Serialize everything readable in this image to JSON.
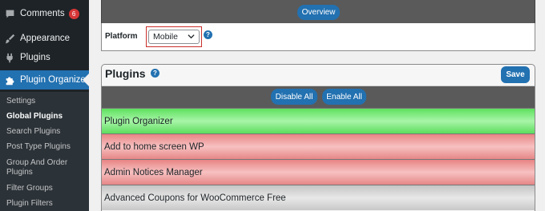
{
  "sidebar": {
    "items": [
      {
        "label": "Comments",
        "icon": "comment-icon",
        "badge": "6"
      },
      {
        "label": "Appearance",
        "icon": "paintbrush-icon"
      },
      {
        "label": "Plugins",
        "icon": "plugin-icon"
      },
      {
        "label": "Plugin Organizer",
        "icon": "puzzle-icon",
        "active": true
      }
    ],
    "submenu": [
      {
        "label": "Settings"
      },
      {
        "label": "Global Plugins",
        "current": true
      },
      {
        "label": "Search Plugins"
      },
      {
        "label": "Post Type Plugins"
      },
      {
        "label": "Group And Order Plugins"
      },
      {
        "label": "Filter Groups"
      },
      {
        "label": "Plugin Filters"
      }
    ],
    "bg_color": "#1d2327",
    "active_color": "#2271b1"
  },
  "overview": {
    "label": "Overview"
  },
  "platform": {
    "label": "Platform",
    "selected": "Mobile",
    "help": "?"
  },
  "plugins": {
    "title": "Plugins",
    "help": "?",
    "save_label": "Save",
    "disable_all_label": "Disable All",
    "enable_all_label": "Enable All",
    "rows": [
      {
        "name": "Plugin Organizer",
        "status": "enabled",
        "color": "#7fe87f"
      },
      {
        "name": "Add to home screen WP",
        "status": "disabled",
        "color": "#f0a0a0"
      },
      {
        "name": "Admin Notices Manager",
        "status": "disabled",
        "color": "#f0a0a0"
      },
      {
        "name": "Advanced Coupons for WooCommerce Free",
        "status": "neutral",
        "color": "#d8d8d8"
      }
    ]
  }
}
